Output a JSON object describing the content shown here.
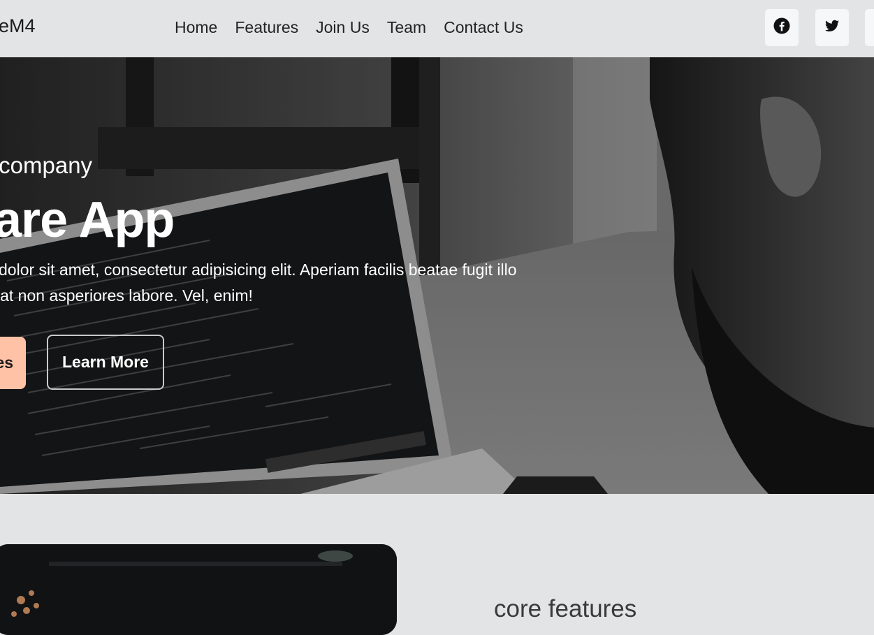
{
  "navbar": {
    "brand": "eM4",
    "links": [
      "Home",
      "Features",
      "Join Us",
      "Team",
      "Contact Us"
    ],
    "social": [
      "facebook-icon",
      "twitter-icon",
      "instagram-icon"
    ]
  },
  "hero": {
    "eyebrow": "r company",
    "title": "ware App",
    "desc_line1": "dolor sit amet, consectetur adipisicing elit. Aperiam facilis beatae fugit illo",
    "desc_line2": "iat non asperiores labore. Vel, enim!",
    "primary_button": "es",
    "secondary_button": "Learn More"
  },
  "features": {
    "heading": "core features"
  },
  "colors": {
    "page_bg": "#e3e4e6",
    "primary_button_bg": "#ffc2a6",
    "social_bg": "#f6f7f8"
  }
}
